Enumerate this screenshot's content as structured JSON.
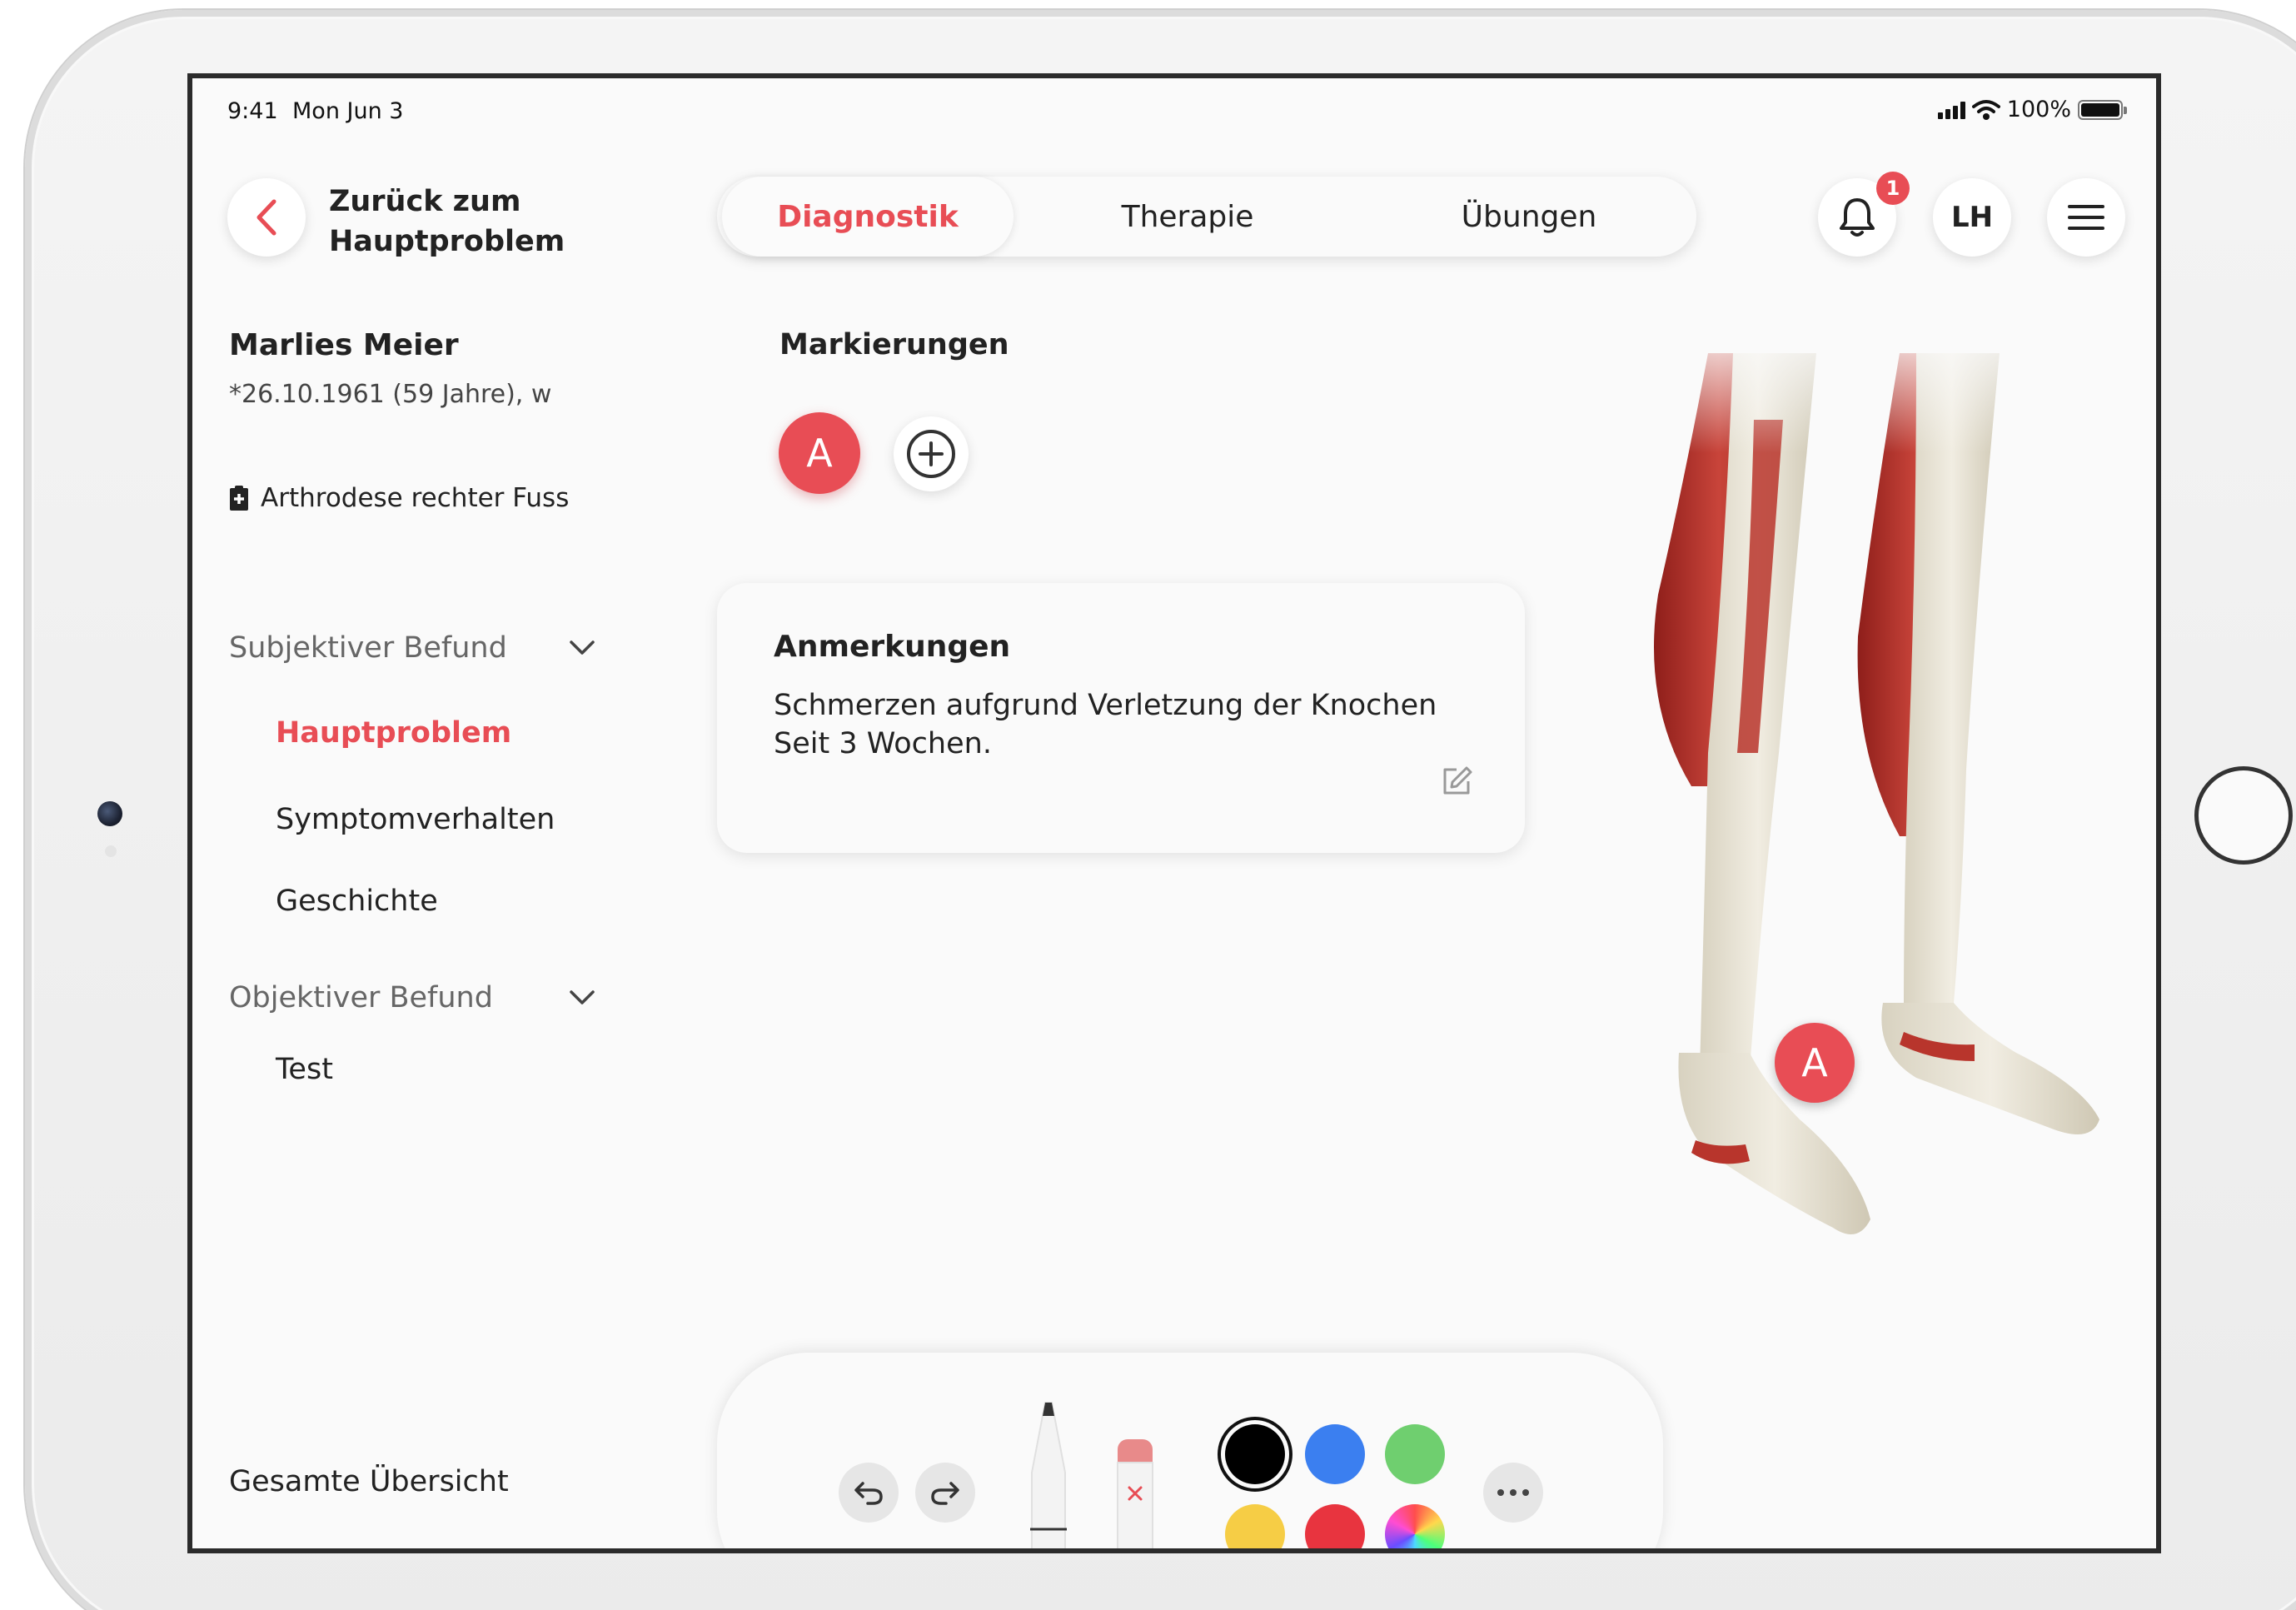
{
  "status_bar": {
    "time": "9:41",
    "date": "Mon Jun 3",
    "battery": "100%"
  },
  "header": {
    "back_label": "Zurück zum Hauptproblem",
    "tabs": [
      {
        "label": "Diagnostik",
        "active": true
      },
      {
        "label": "Therapie",
        "active": false
      },
      {
        "label": "Übungen",
        "active": false
      }
    ],
    "notification_count": "1",
    "user_initials": "LH"
  },
  "patient": {
    "name": "Marlies Meier",
    "dob": "*26.10.1961 (59 Jahre), w",
    "diagnosis": "Arthrodese rechter Fuss"
  },
  "sidebar": {
    "sections": [
      {
        "label": "Subjektiver Befund",
        "items": [
          "Hauptproblem",
          "Symptomverhalten",
          "Geschichte"
        ]
      },
      {
        "label": "Objektiver Befund",
        "items": [
          "Test"
        ]
      }
    ],
    "active_item": "Hauptproblem",
    "overview_label": "Gesamte Übersicht"
  },
  "markers": {
    "title": "Markierungen",
    "items": [
      "A"
    ]
  },
  "notes": {
    "title": "Anmerkungen",
    "text": "Schmerzen aufgrund Verletzung der Knochen Seit 3 Wochen."
  },
  "model": {
    "marker_label": "A"
  },
  "colors": {
    "accent": "#e84d55",
    "swatches": [
      "#000000",
      "#3b7ff0",
      "#6fcf6f",
      "#f6cd45",
      "#e8343f",
      "rainbow"
    ],
    "selected_swatch": "#000000"
  }
}
